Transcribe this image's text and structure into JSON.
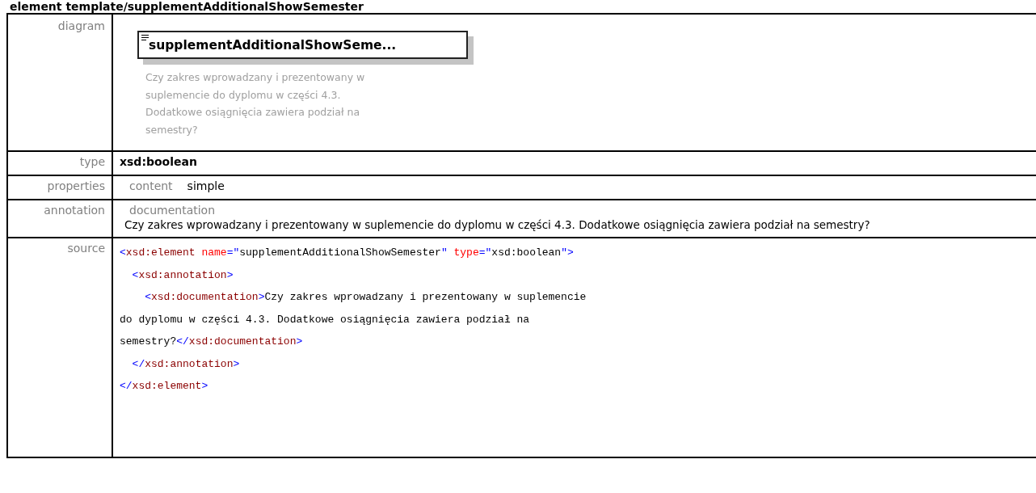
{
  "heading": "element template/supplementAdditionalShowSemester",
  "rows": [
    {
      "label": "diagram",
      "kind": "diagram",
      "element_name": "supplementAdditionalShowSeme...",
      "description": "Czy zakres wprowadzany i prezentowany w suplemencie do dyplomu w części 4.3. Dodatkowe osiągnięcia zawiera podział na semestry?"
    },
    {
      "label": "type",
      "kind": "type",
      "value": "xsd:boolean"
    },
    {
      "label": "properties",
      "kind": "properties",
      "items": [
        {
          "name": "content",
          "value": "simple"
        }
      ]
    },
    {
      "label": "annotation",
      "kind": "annotation",
      "title": "documentation",
      "text": "Czy zakres wprowadzany i prezentowany w suplemencie do dyplomu w części 4.3. Dodatkowe osiągnięcia zawiera podział na semestry?"
    },
    {
      "label": "source",
      "kind": "source",
      "lines": [
        [
          {
            "kind": "bracket",
            "text": "<"
          },
          {
            "kind": "tag",
            "text": "xsd:element"
          },
          {
            "kind": "attr",
            "text": " name"
          },
          {
            "kind": "bracket",
            "text": "=\""
          },
          {
            "kind": "value",
            "text": "supplementAdditionalShowSemester"
          },
          {
            "kind": "bracket",
            "text": "\""
          },
          {
            "kind": "attr",
            "text": " type"
          },
          {
            "kind": "bracket",
            "text": "=\""
          },
          {
            "kind": "value",
            "text": "xsd:boolean"
          },
          {
            "kind": "bracket",
            "text": "\">"
          }
        ],
        [
          {
            "kind": "bracket",
            "text": "  <"
          },
          {
            "kind": "tag",
            "text": "xsd:annotation"
          },
          {
            "kind": "bracket",
            "text": ">"
          }
        ],
        [
          {
            "kind": "bracket",
            "text": "    <"
          },
          {
            "kind": "tag",
            "text": "xsd:documentation"
          },
          {
            "kind": "bracket",
            "text": ">"
          },
          {
            "kind": "value",
            "text": "Czy zakres wprowadzany i prezentowany w suplemencie"
          }
        ],
        [
          {
            "kind": "value",
            "text": "do dyplomu w części 4.3. Dodatkowe osiągnięcia zawiera podział na"
          }
        ],
        [
          {
            "kind": "value",
            "text": "semestry?"
          },
          {
            "kind": "bracket",
            "text": "</"
          },
          {
            "kind": "tag",
            "text": "xsd:documentation"
          },
          {
            "kind": "bracket",
            "text": ">"
          }
        ],
        [
          {
            "kind": "bracket",
            "text": "  </"
          },
          {
            "kind": "tag",
            "text": "xsd:annotation"
          },
          {
            "kind": "bracket",
            "text": ">"
          }
        ],
        [
          {
            "kind": "bracket",
            "text": "</"
          },
          {
            "kind": "tag",
            "text": "xsd:element"
          },
          {
            "kind": "bracket",
            "text": ">"
          }
        ]
      ]
    }
  ]
}
